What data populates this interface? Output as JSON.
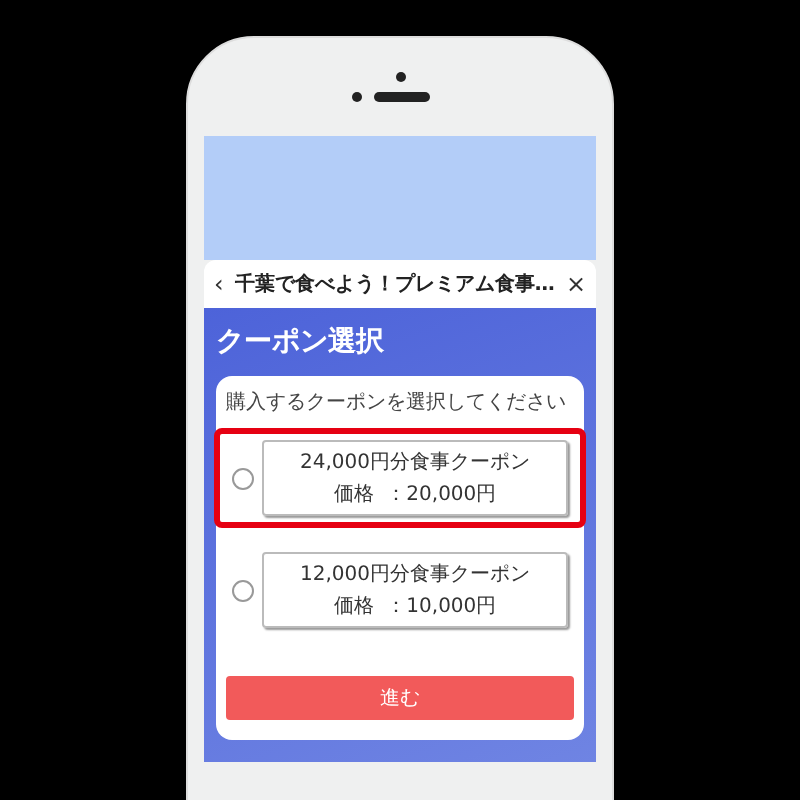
{
  "modal": {
    "title": "千葉で食べよう！プレミアム食事…",
    "back_icon": "‹",
    "close_icon": "×",
    "heading": "クーポン選択",
    "prompt": "購入するクーポンを選択してください",
    "coupons": [
      {
        "name": "24,000円分食事クーポン",
        "price_label": "価格",
        "price": "：20,000円",
        "checked": false,
        "highlighted": true
      },
      {
        "name": "12,000円分食事クーポン",
        "price_label": "価格",
        "price": "：10,000円",
        "checked": false,
        "highlighted": false
      }
    ],
    "submit_button": "進む"
  }
}
